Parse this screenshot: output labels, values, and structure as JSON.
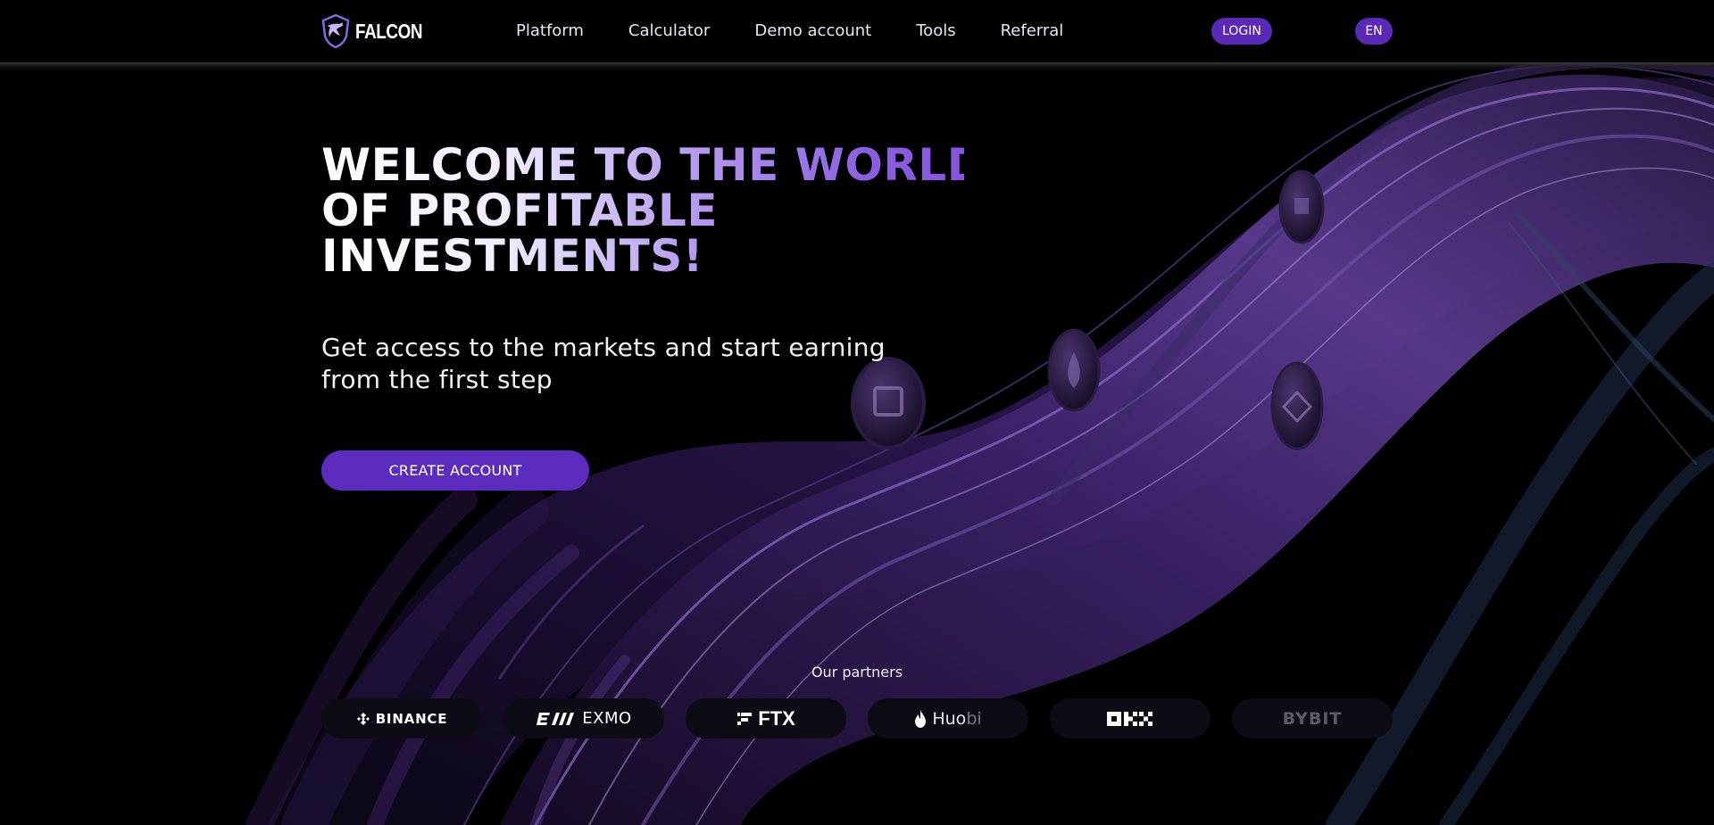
{
  "brand": {
    "name": "FALCON",
    "logo_icon": "falcon-shield-icon"
  },
  "nav": {
    "items": [
      {
        "label": "Platform"
      },
      {
        "label": "Calculator"
      },
      {
        "label": "Demo account"
      },
      {
        "label": "Tools"
      },
      {
        "label": "Referral"
      }
    ]
  },
  "header": {
    "login_label": "LOGIN",
    "language_label": "EN"
  },
  "hero": {
    "title_lines": [
      "WELCOME TO THE WORLD",
      "OF PROFITABLE",
      "INVESTMENTS!"
    ],
    "subtitle_lines": [
      "Get access to the markets and start earning",
      "from the first step"
    ],
    "cta_label": "CREATE ACCOUNT"
  },
  "partners": {
    "title": "Our partners",
    "items": [
      {
        "name": "BINANCE",
        "icon": "binance-diamond-icon"
      },
      {
        "name": "EXMO",
        "icon": "exmo-logo-icon"
      },
      {
        "name": "FTX",
        "icon": "ftx-logo-icon"
      },
      {
        "name_main": "Huo",
        "name_dim": "bi",
        "icon": "huobi-flame-icon"
      },
      {
        "name": "OKX",
        "icon": "okx-logo-icon"
      },
      {
        "name": "BYBIT",
        "icon": "bybit-logo-icon"
      }
    ]
  },
  "colors": {
    "accent": "#5a29b8",
    "background": "#000000",
    "title_gradient_end": "#8556dc",
    "partner_pill": "#0d0b14"
  }
}
